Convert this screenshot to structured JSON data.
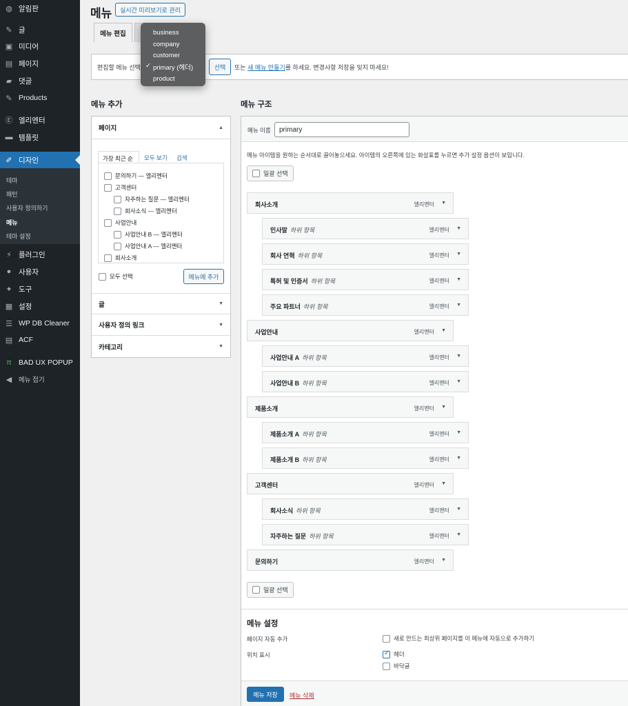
{
  "sidebar": {
    "items": [
      {
        "label": "알림판",
        "icon": "dashboard-icon"
      },
      {
        "label": "글",
        "icon": "pin-icon"
      },
      {
        "label": "미디어",
        "icon": "media-icon"
      },
      {
        "label": "페이지",
        "icon": "page-icon"
      },
      {
        "label": "댓글",
        "icon": "comment-icon"
      },
      {
        "label": "Products",
        "icon": "pin-icon"
      },
      {
        "label": "엘리멘터",
        "icon": "elementor-icon"
      },
      {
        "label": "템플릿",
        "icon": "folder-icon"
      },
      {
        "label": "디자인",
        "icon": "brush-icon"
      },
      {
        "label": "플러그인",
        "icon": "plugin-icon"
      },
      {
        "label": "사용자",
        "icon": "user-icon"
      },
      {
        "label": "도구",
        "icon": "wrench-icon"
      },
      {
        "label": "설정",
        "icon": "settings-icon"
      },
      {
        "label": "WP DB Cleaner",
        "icon": "database-icon"
      },
      {
        "label": "ACF",
        "icon": "acf-icon"
      },
      {
        "label": "BAD UX POPUP",
        "icon": "pi-icon"
      },
      {
        "label": "메뉴 접기",
        "icon": "collapse-icon"
      }
    ],
    "design_sub": [
      "테마",
      "패턴",
      "사용자 정의하기",
      "메뉴",
      "테마 설정"
    ]
  },
  "header": {
    "title": "메뉴",
    "live_preview_btn": "실시간 미리보기로 관리",
    "tab_edit": "메뉴 편집"
  },
  "select_bar": {
    "label": "편집할 메뉴 선택:",
    "select_btn": "선택",
    "or_text": "또는",
    "create_link": "새 메뉴 만들기",
    "after_text": "를 하세요. 변경사항 저장을 잊지 마세요!"
  },
  "dropdown": {
    "options": [
      "business",
      "company",
      "customer",
      "primary (헤더)",
      "product"
    ],
    "selected": "primary (헤더)"
  },
  "add_menu": {
    "heading": "메뉴 추가",
    "pages_title": "페이지",
    "subtabs": [
      "가장 최근 순",
      "모두 보기",
      "검색"
    ],
    "pages": [
      {
        "label": "문의하기 — 엘리멘터",
        "indent": 0
      },
      {
        "label": "고객센터",
        "indent": 0
      },
      {
        "label": "자주하는 질문 — 엘리멘터",
        "indent": 1
      },
      {
        "label": "회사소식 — 엘리멘터",
        "indent": 1
      },
      {
        "label": "사업안내",
        "indent": 0
      },
      {
        "label": "사업안내 B — 엘리멘터",
        "indent": 1
      },
      {
        "label": "사업안내 A — 엘리멘터",
        "indent": 1
      },
      {
        "label": "회사소개",
        "indent": 0
      }
    ],
    "select_all": "모두 선택",
    "add_btn": "메뉴에 추가",
    "sections": [
      "글",
      "사용자 정의 링크",
      "카테고리"
    ]
  },
  "structure": {
    "heading": "메뉴 구조",
    "name_label": "메뉴 이름",
    "name_value": "primary",
    "instructions": "메뉴 아이템을 원하는 순서대로 끌어놓으세요. 아이템의 오른쪽에 있는 화살표를 누르면 추가 설정 옵션이 보입니다.",
    "bulk_select": "일괄 선택",
    "sub_label": "하위 항목",
    "type_label": "엘리멘터",
    "items": [
      {
        "title": "회사소개",
        "depth": 0
      },
      {
        "title": "인사말",
        "depth": 1
      },
      {
        "title": "회사 연혁",
        "depth": 1
      },
      {
        "title": "특허 및 인증서",
        "depth": 1
      },
      {
        "title": "주요 파트너",
        "depth": 1
      },
      {
        "title": "사업안내",
        "depth": 0
      },
      {
        "title": "사업안내 A",
        "depth": 1
      },
      {
        "title": "사업안내 B",
        "depth": 1
      },
      {
        "title": "제품소개",
        "depth": 0
      },
      {
        "title": "제품소개 A",
        "depth": 1
      },
      {
        "title": "제품소개 B",
        "depth": 1
      },
      {
        "title": "고객센터",
        "depth": 0
      },
      {
        "title": "회사소식",
        "depth": 1
      },
      {
        "title": "자주하는 질문",
        "depth": 1
      },
      {
        "title": "문의하기",
        "depth": 0
      }
    ]
  },
  "settings": {
    "heading": "메뉴 설정",
    "auto_add_label": "페이지 자동 추가",
    "auto_add_opt": "새로 만드는 최상위 페이지를 이 메뉴에 자동으로 추가하기",
    "location_label": "위치 표시",
    "loc_header": "헤더",
    "loc_footer": "바닥글",
    "save_btn": "메뉴 저장",
    "delete_link": "메뉴 삭제"
  },
  "colors": {
    "accent": "#2271b1",
    "sidebar_bg": "#1d2327",
    "delete": "#b32d2e"
  }
}
